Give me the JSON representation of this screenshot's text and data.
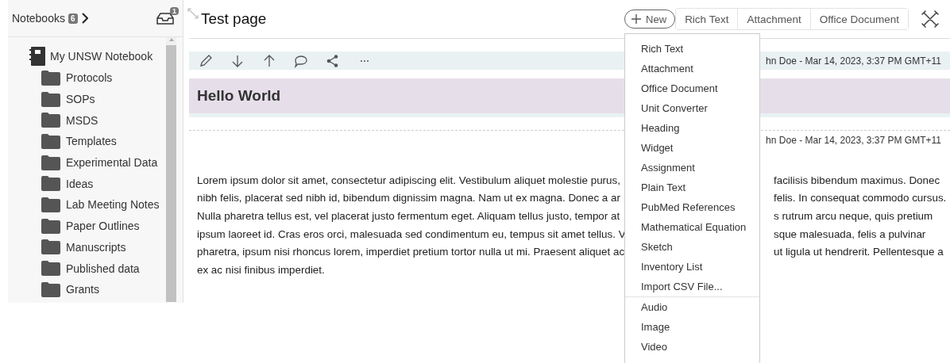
{
  "sidebar": {
    "title": "Notebooks",
    "count": "6",
    "inbox_badge": "1",
    "tree": [
      {
        "label": "My UNSW Notebook",
        "kind": "notebook",
        "children": [
          {
            "label": "Protocols",
            "kind": "folder"
          },
          {
            "label": "SOPs",
            "kind": "folder"
          },
          {
            "label": "MSDS",
            "kind": "folder"
          },
          {
            "label": "Templates",
            "kind": "folder"
          },
          {
            "label": "Experimental Data",
            "kind": "folder"
          },
          {
            "label": "Ideas",
            "kind": "folder"
          },
          {
            "label": "Lab Meeting Notes",
            "kind": "folder"
          },
          {
            "label": "Paper Outlines",
            "kind": "folder"
          },
          {
            "label": "Manuscripts",
            "kind": "folder"
          },
          {
            "label": "Published data",
            "kind": "folder"
          },
          {
            "label": "Grants",
            "kind": "folder"
          }
        ]
      }
    ]
  },
  "page": {
    "title": "Test page",
    "new_button": "New",
    "quick_add": [
      "Rich Text",
      "Attachment",
      "Office Document"
    ]
  },
  "entries": [
    {
      "kind": "heading",
      "meta": "hn Doe - Mar 14, 2023, 3:37 PM GMT+11",
      "text": "Hello World"
    },
    {
      "kind": "text",
      "meta": "hn Doe - Mar 14, 2023, 3:37 PM GMT+11",
      "lines": [
        {
          "left": "Lorem ipsum dolor sit amet, consectetur adipiscing elit. Vestibulum aliquet molestie purus,",
          "right": "facilisis bibendum maximus. Donec"
        },
        {
          "left": "nibh felis, placerat sed nibh id, bibendum dignissim magna. Nam ut ex magna. Donec a ar",
          "right": "felis. In consequat commodo cursus."
        },
        {
          "left": "Nulla pharetra tellus est, vel placerat justo fermentum eget. Aliquam tellus justo, tempor at",
          "right": "s rutrum arcu neque, quis pretium"
        },
        {
          "left": "ipsum laoreet id. Cras eros orci, malesuada sed condimentum eu, tempus sit amet tellus. V",
          "right": "sque malesuada, felis a pulvinar"
        },
        {
          "left": "pharetra, ipsum nisi rhoncus lorem, imperdiet pretium tortor nulla ut mi. Praesent aliquet ac",
          "right": "ut ligula ut hendrerit. Pellentesque a"
        },
        {
          "left": "ex ac nisi finibus imperdiet."
        }
      ]
    }
  ],
  "new_menu": {
    "groups": [
      [
        "Rich Text",
        "Attachment",
        "Office Document",
        "Unit Converter",
        "Heading",
        "Widget",
        "Assignment",
        "Plain Text",
        "PubMed References",
        "Mathematical Equation",
        "Sketch",
        "Inventory List",
        "Import CSV File..."
      ],
      [
        "Audio",
        "Image",
        "Video"
      ]
    ]
  }
}
